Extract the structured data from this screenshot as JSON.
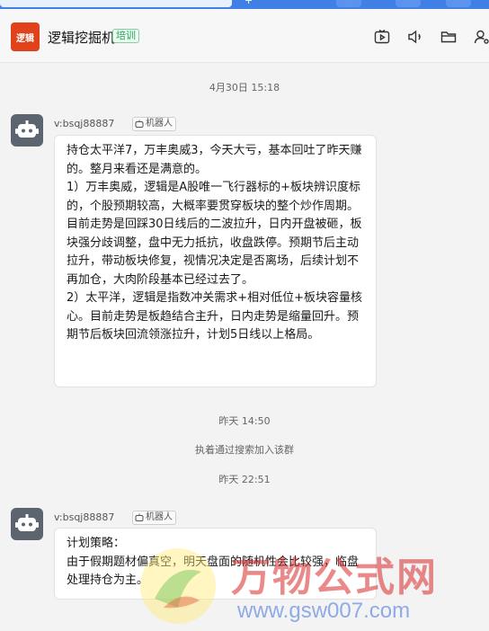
{
  "header": {
    "group_avatar_text": "逻辑",
    "group_name": "逻辑挖掘机",
    "group_tag": "培训",
    "icons": [
      "tv-icon",
      "speaker-icon",
      "folder-icon",
      "user-settings-icon"
    ]
  },
  "messages": [
    {
      "timestamp": "4月30日 15:18",
      "sender": "v:bsqj88887",
      "badge": "机器人",
      "text": "持仓太平洋7，万丰奥威3，今天大亏，基本回吐了昨天赚的。整月来看还是满意的。\n1）万丰奥威，逻辑是A股唯一飞行器标的+板块辨识度标的，个股预期较高，大概率要贯穿板块的整个炒作周期。目前走势是回踩30日线后的二波拉升，日内开盘被砸，板块强分歧调整，盘中无力抵抗，收盘跌停。预期节后主动拉升，带动板块修复，视情况决定是否离场，后续计划不再加仓，大肉阶段基本已经过去了。\n2）太平洋，逻辑是指数冲关需求+相对低位+板块容量核心。目前走势是板趋结合主升，日内走势是缩量回升。预期节后板块回流领涨拉升，计划5日线以上格局。"
    },
    {
      "timestamp": "昨天 22:51",
      "sender": "v:bsqj88887",
      "badge": "机器人",
      "text": "计划策略：\n由于假期题材偏真空，明天盘面的随机性会比较强，临盘处理持仓为主。"
    }
  ],
  "system": {
    "timestamp": "昨天 14:50",
    "note": "执着通过搜索加入该群"
  },
  "watermark": {
    "cn": "万物公式网",
    "url": "www.gsw007.com"
  },
  "colors": {
    "accent": "#3f7fe6",
    "group_avatar": "#e0431b",
    "tag_green": "#25a35a",
    "bot_avatar": "#5c6470"
  }
}
